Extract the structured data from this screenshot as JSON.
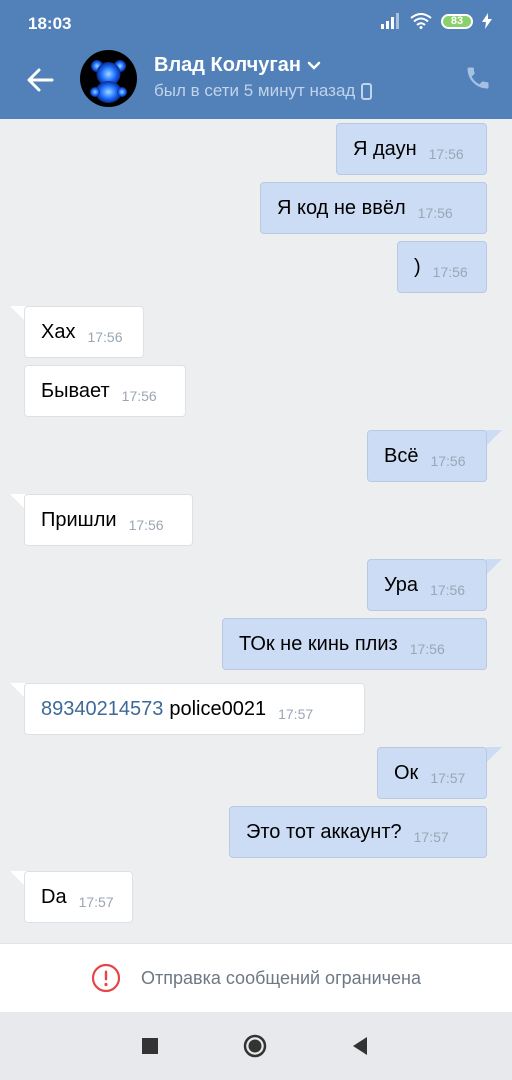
{
  "status_bar": {
    "time": "18:03",
    "battery": "83"
  },
  "header": {
    "contact_name": "Влад Колчуган",
    "last_seen": "был в сети 5 минут назад"
  },
  "messages": [
    {
      "dir": "out",
      "text": "Я даун",
      "time": "17:56"
    },
    {
      "dir": "out",
      "text": "Я код не ввёл",
      "time": "17:56"
    },
    {
      "dir": "out",
      "text": ")",
      "time": "17:56"
    },
    {
      "dir": "in",
      "text": "Хах",
      "time": "17:56"
    },
    {
      "dir": "in",
      "text": "Бывает",
      "time": "17:56"
    },
    {
      "dir": "out",
      "text": "Всё",
      "time": "17:56"
    },
    {
      "dir": "in",
      "text": "Пришли",
      "time": "17:56"
    },
    {
      "dir": "out",
      "text": "Ура",
      "time": "17:56"
    },
    {
      "dir": "out",
      "text": "ТОк не кинь плиз",
      "time": "17:56"
    },
    {
      "dir": "in",
      "phone": "89340214573",
      "text": "police0021",
      "time": "17:57"
    },
    {
      "dir": "out",
      "text": "Ок",
      "time": "17:57"
    },
    {
      "dir": "out",
      "text": "Это тот аккаунт?",
      "time": "17:57"
    },
    {
      "dir": "in",
      "text": "Da",
      "time": "17:57"
    }
  ],
  "restricted_notice": "Отправка сообщений ограничена",
  "icons": {
    "back": "arrow-left-icon",
    "call": "phone-icon",
    "warning": "exclamation-circle-icon",
    "nav": [
      "square-icon",
      "circle-icon",
      "triangle-back-icon"
    ]
  },
  "colors": {
    "header": "#5181b8",
    "outgoing_bubble": "#cddcf5",
    "incoming_bubble": "#ffffff",
    "background": "#edeef0",
    "warning": "#e64646"
  }
}
